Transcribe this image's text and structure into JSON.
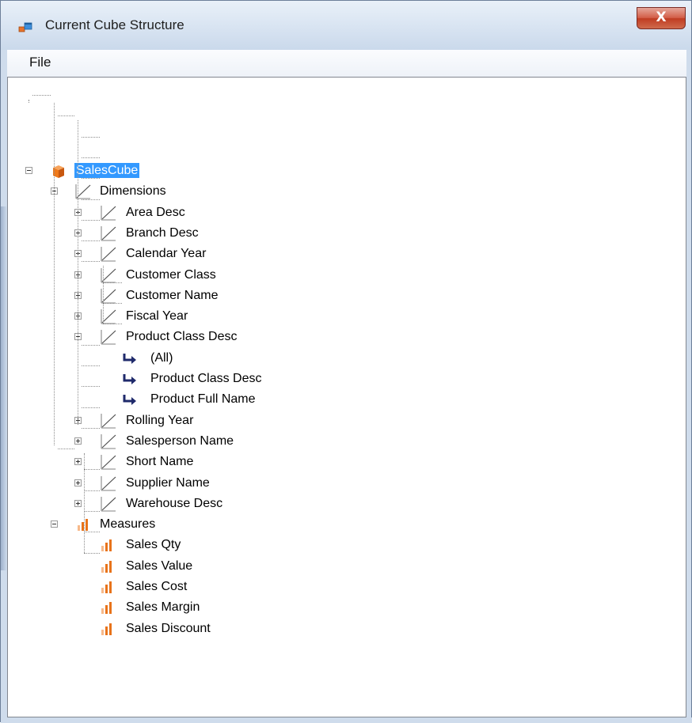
{
  "window": {
    "title": "Current Cube Structure",
    "close_label": "X"
  },
  "menu": {
    "file_label": "File"
  },
  "tree": {
    "root_label": "SalesCube",
    "dimensions_label": "Dimensions",
    "dimensions": [
      "Area Desc",
      "Branch Desc",
      "Calendar Year",
      "Customer Class",
      "Customer Name",
      "Fiscal Year",
      "Product Class Desc",
      "Rolling Year",
      "Salesperson Name",
      "Short Name",
      "Supplier Name",
      "Warehouse Desc"
    ],
    "expanded_dimension": "Product Class Desc",
    "levels": [
      "(All)",
      "Product Class Desc",
      "Product Full Name"
    ],
    "measures_label": "Measures",
    "measures": [
      "Sales Qty",
      "Sales Value",
      "Sales Cost",
      "Sales Margin",
      "Sales Discount"
    ]
  },
  "icons": {
    "app": "window-app-icon",
    "cube": "cube-icon",
    "dimension": "dimension-icon",
    "level": "level-arrow-icon",
    "measure": "bar-chart-icon",
    "expand": "plus-box-icon",
    "collapse": "minus-box-icon"
  },
  "colors": {
    "selection": "#3399ff",
    "cube": "#f07a1a",
    "level_arrow": "#1f2a6b",
    "bar_dark": "#e8731a",
    "bar_light": "#f7b98a",
    "close_button": "#c7472b"
  }
}
